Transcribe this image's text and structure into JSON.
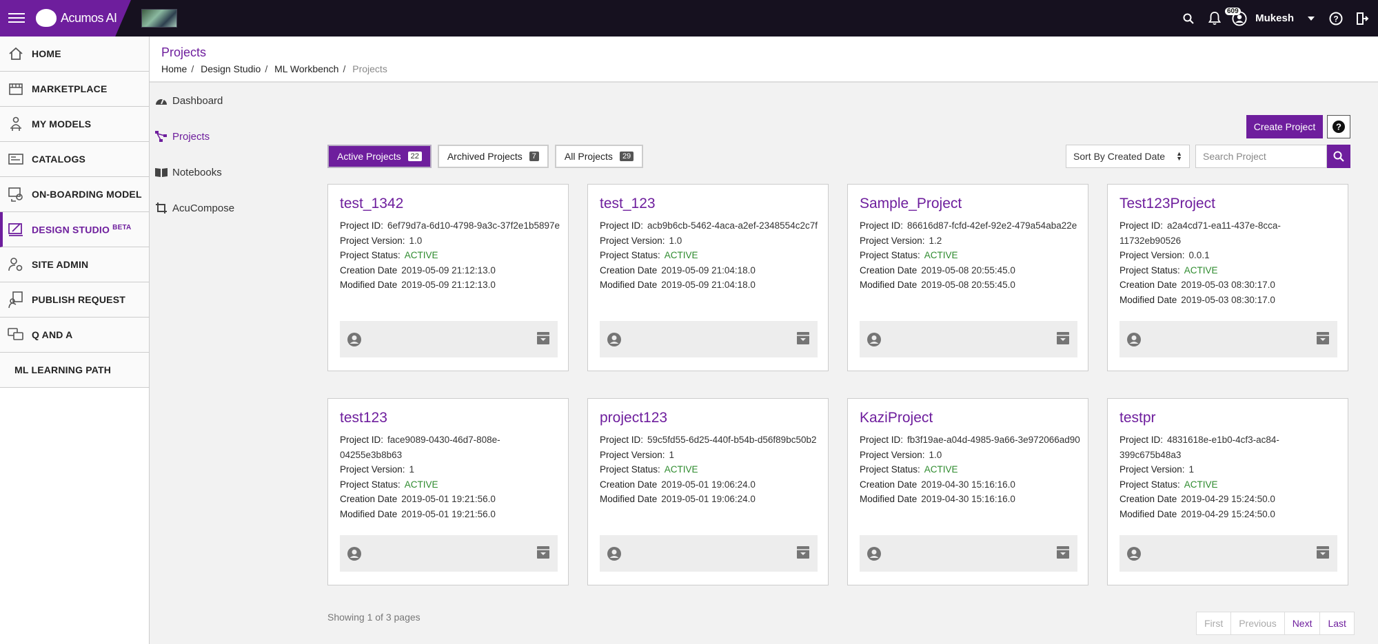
{
  "app": {
    "brand": "Acumos AI"
  },
  "topbar": {
    "notification_count": "609",
    "user_name": "Mukesh"
  },
  "leftnav": {
    "items": [
      {
        "label": "HOME",
        "icon": "home-icon"
      },
      {
        "label": "MARKETPLACE",
        "icon": "store-icon"
      },
      {
        "label": "MY MODELS",
        "icon": "person-desk-icon"
      },
      {
        "label": "CATALOGS",
        "icon": "catalog-icon"
      },
      {
        "label": "ON-BOARDING MODEL",
        "icon": "onboarding-icon"
      },
      {
        "label": "DESIGN STUDIO",
        "sup": "BETA",
        "icon": "design-studio-icon"
      },
      {
        "label": "SITE ADMIN",
        "icon": "admin-icon"
      },
      {
        "label": "PUBLISH REQUEST",
        "icon": "publish-icon"
      },
      {
        "label": "Q AND A",
        "icon": "qa-icon"
      },
      {
        "label": "ML LEARNING PATH",
        "icon": ""
      }
    ]
  },
  "header": {
    "title": "Projects",
    "breadcrumb": [
      "Home",
      "Design Studio",
      "ML Workbench",
      "Projects"
    ]
  },
  "subnav": {
    "items": [
      {
        "label": "Dashboard",
        "icon": "dashboard-icon"
      },
      {
        "label": "Projects",
        "icon": "projects-icon"
      },
      {
        "label": "Notebooks",
        "icon": "notebook-icon"
      },
      {
        "label": "AcuCompose",
        "icon": "compose-icon"
      }
    ]
  },
  "toolbar": {
    "create_label": "Create Project",
    "tabs": [
      {
        "label": "Active Projects",
        "count": "22"
      },
      {
        "label": "Archived Projects",
        "count": "7"
      },
      {
        "label": "All Projects",
        "count": "29"
      }
    ],
    "sort_value": "Sort By Created Date",
    "search_placeholder": "Search Project"
  },
  "labels": {
    "id": "Project ID:",
    "version": "Project Version:",
    "status": "Project Status:",
    "created": "Creation Date",
    "modified": "Modified Date"
  },
  "projects": [
    {
      "name": "test_1342",
      "id": "6ef79d7a-6d10-4798-9a3c-37f2e1b5897e",
      "version": "1.0",
      "status": "ACTIVE",
      "created": "2019-05-09 21:12:13.0",
      "modified": "2019-05-09 21:12:13.0"
    },
    {
      "name": "test_123",
      "id": "acb9b6cb-5462-4aca-a2ef-2348554c2c7f",
      "version": "1.0",
      "status": "ACTIVE",
      "created": "2019-05-09 21:04:18.0",
      "modified": "2019-05-09 21:04:18.0"
    },
    {
      "name": "Sample_Project",
      "id": "86616d87-fcfd-42ef-92e2-479a54aba22e",
      "version": "1.2",
      "status": "ACTIVE",
      "created": "2019-05-08 20:55:45.0",
      "modified": "2019-05-08 20:55:45.0"
    },
    {
      "name": "Test123Project",
      "id": "a2a4cd71-ea11-437e-8cca-11732eb90526",
      "version": "0.0.1",
      "status": "ACTIVE",
      "created": "2019-05-03 08:30:17.0",
      "modified": "2019-05-03 08:30:17.0"
    },
    {
      "name": "test123",
      "id": "face9089-0430-46d7-808e-04255e3b8b63",
      "version": "1",
      "status": "ACTIVE",
      "created": "2019-05-01 19:21:56.0",
      "modified": "2019-05-01 19:21:56.0"
    },
    {
      "name": "project123",
      "id": "59c5fd55-6d25-440f-b54b-d56f89bc50b2",
      "version": "1",
      "status": "ACTIVE",
      "created": "2019-05-01 19:06:24.0",
      "modified": "2019-05-01 19:06:24.0"
    },
    {
      "name": "KaziProject",
      "id": "fb3f19ae-a04d-4985-9a66-3e972066ad90",
      "version": "1.0",
      "status": "ACTIVE",
      "created": "2019-04-30 15:16:16.0",
      "modified": "2019-04-30 15:16:16.0"
    },
    {
      "name": "testpr",
      "id": "4831618e-e1b0-4cf3-ac84-399c675b48a3",
      "version": "1",
      "status": "ACTIVE",
      "created": "2019-04-29 15:24:50.0",
      "modified": "2019-04-29 15:24:50.0"
    }
  ],
  "pagination": {
    "showing": "Showing 1 of 3 pages",
    "first": "First",
    "previous": "Previous",
    "next": "Next",
    "last": "Last"
  },
  "colors": {
    "brand": "#6e1e9d",
    "topbar": "#16111f",
    "active_status": "#2e8b2e"
  }
}
